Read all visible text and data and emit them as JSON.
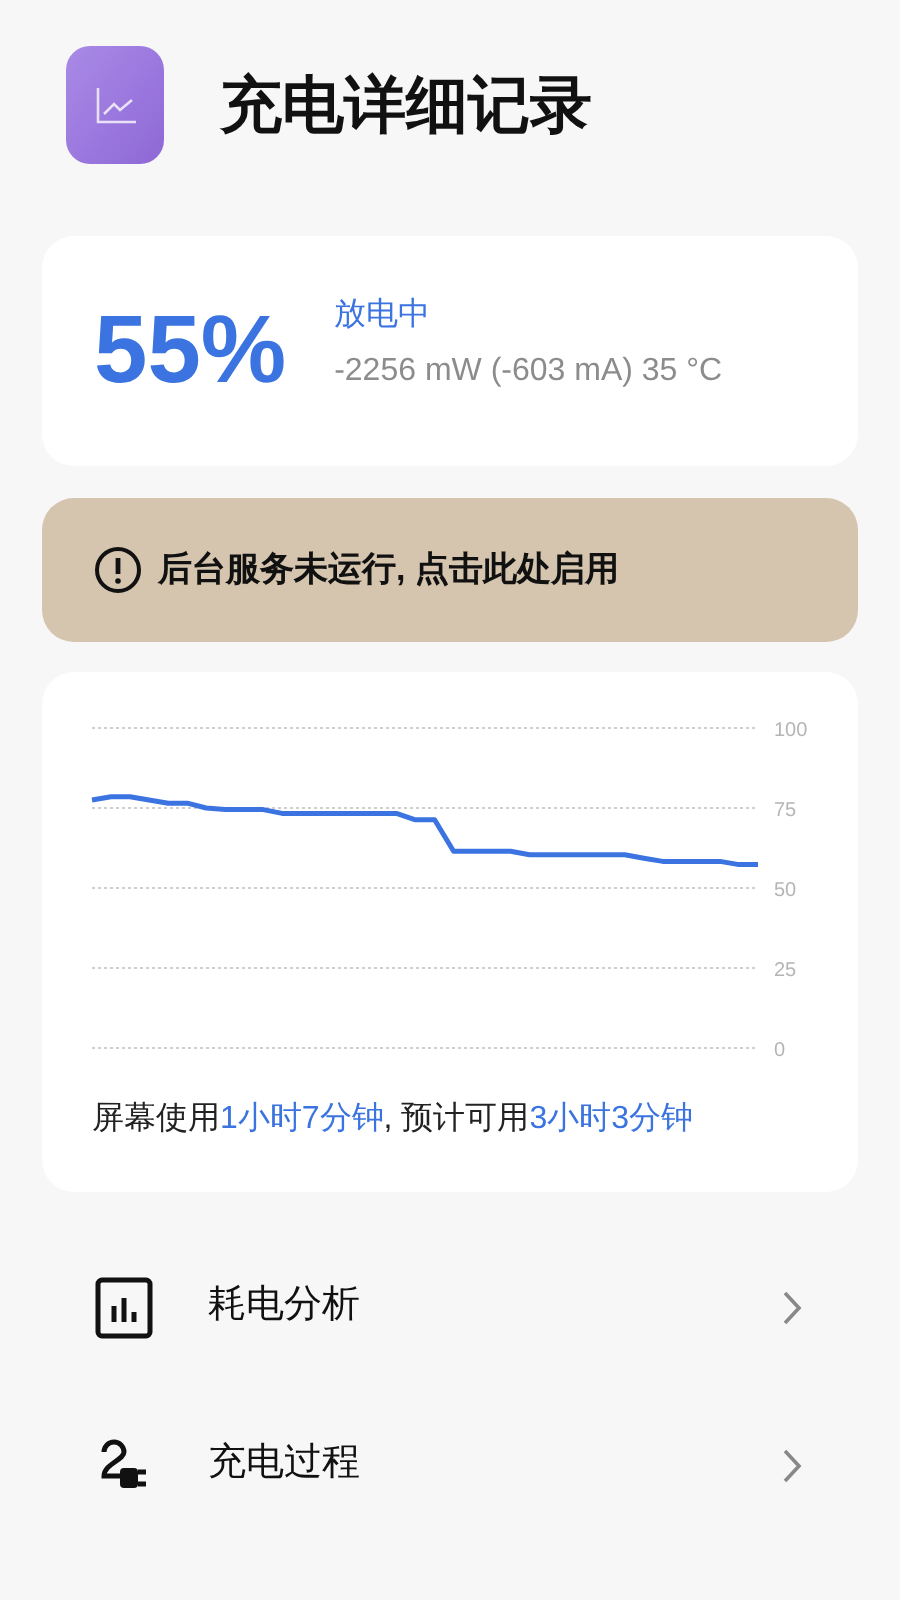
{
  "header": {
    "title": "充电详细记录"
  },
  "battery": {
    "percent": "55%",
    "status": "放电中",
    "details": "-2256 mW (-603 mA) 35 °C"
  },
  "banner": {
    "text": "后台服务未运行, 点击此处启用"
  },
  "chart_data": {
    "type": "line",
    "grid": true,
    "series": [
      {
        "color": "#3b74e0",
        "values": [
          77.5,
          78.5,
          78.5,
          77.5,
          76.5,
          76.5,
          75,
          74.5,
          74.5,
          74.5,
          73.3,
          73.3,
          73.3,
          73.3,
          73.3,
          73.3,
          73.3,
          71.3,
          71.3,
          61.5,
          61.5,
          61.5,
          61.5,
          60.4,
          60.4,
          60.4,
          60.4,
          60.4,
          60.4,
          59.3,
          58.3,
          58.3,
          58.3,
          58.3,
          57.3,
          57.3
        ]
      }
    ],
    "ylim": [
      0,
      100
    ],
    "yticks": [
      0,
      25,
      50,
      75,
      100
    ]
  },
  "usage": [
    {
      "text": "屏幕使用",
      "highlight": false
    },
    {
      "text": "1小时7分钟",
      "highlight": true
    },
    {
      "text": ", 预计可用",
      "highlight": false
    },
    {
      "text": "3小时3分钟",
      "highlight": true
    }
  ],
  "menu": [
    {
      "kind": "analysis",
      "label": "耗电分析"
    },
    {
      "kind": "charging",
      "label": "充电过程"
    }
  ]
}
